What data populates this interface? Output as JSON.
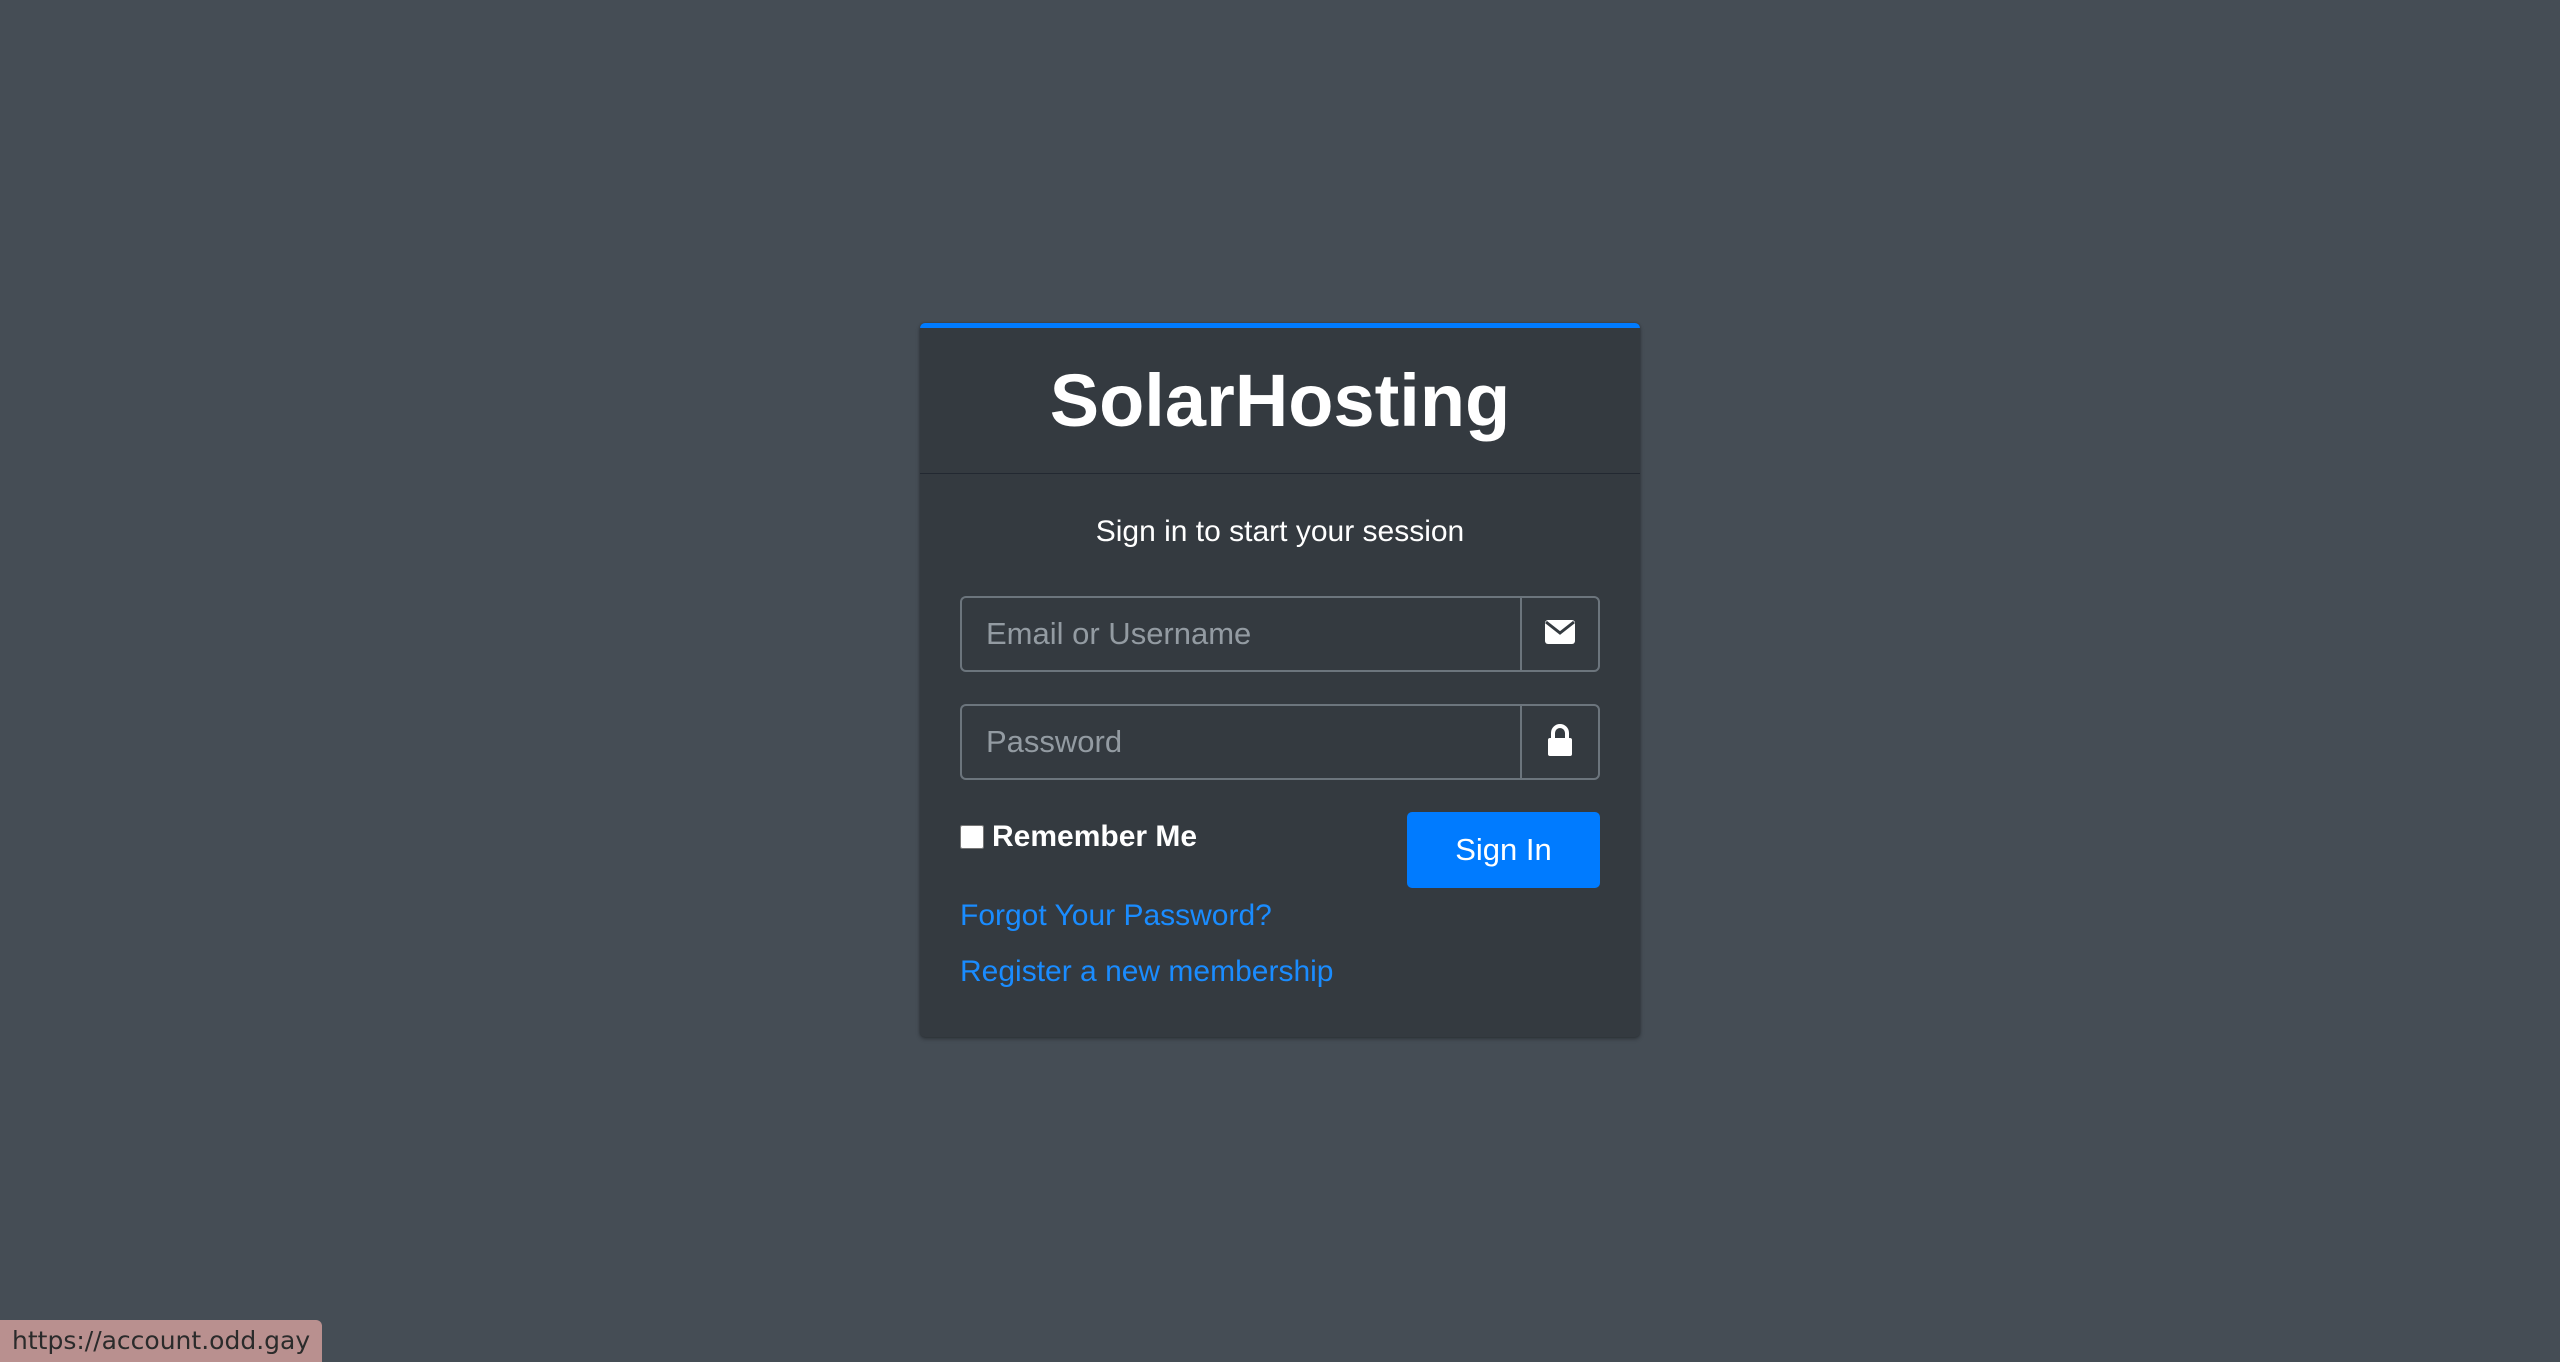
{
  "brand": {
    "title": "SolarHosting"
  },
  "login": {
    "message": "Sign in to start your session",
    "email_placeholder": "Email or Username",
    "password_placeholder": "Password",
    "remember_label": "Remember Me",
    "signin_label": "Sign In",
    "forgot_link": "Forgot Your Password?",
    "register_link": "Register a new membership"
  },
  "icons": {
    "email": "envelope-icon",
    "password": "lock-icon"
  },
  "status_bar": {
    "url": "https://account.odd.gay"
  },
  "colors": {
    "background": "#454d55",
    "card": "#343a40",
    "accent": "#007bff",
    "link": "#1a8cff"
  }
}
